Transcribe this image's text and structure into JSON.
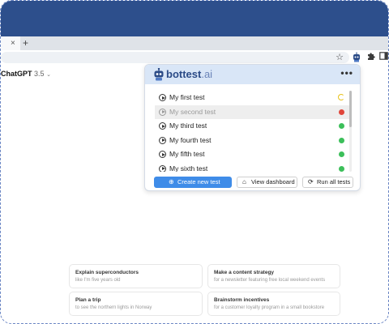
{
  "browser": {
    "tab_close": "×",
    "new_tab": "+",
    "toolbar_icons": {
      "star": "star-icon",
      "extension_avatar": "bottest-extension-icon",
      "extensions": "puzzle-icon",
      "sidepanel": "sidepanel-icon"
    }
  },
  "chatgpt": {
    "model_name": "ChatGPT",
    "model_version": "3.5",
    "model_chevron": "⌄",
    "suggestions": [
      {
        "title": "Explain superconductors",
        "subtitle": "like I'm five years old"
      },
      {
        "title": "Make a content strategy",
        "subtitle": "for a newsletter featuring free local weekend events"
      },
      {
        "title": "Plan a trip",
        "subtitle": "to see the northern lights in Norway"
      },
      {
        "title": "Brainstorm incentives",
        "subtitle": "for a customer loyalty program in a small bookstore"
      }
    ]
  },
  "bottest": {
    "brand": "bottest",
    "brand_suffix": ".ai",
    "more": "•••",
    "tests": [
      {
        "name": "My first test",
        "status": "running"
      },
      {
        "name": "My second test",
        "status": "failed"
      },
      {
        "name": "My third test",
        "status": "passed"
      },
      {
        "name": "My fourth test",
        "status": "passed"
      },
      {
        "name": "My fifth test",
        "status": "passed"
      },
      {
        "name": "My sixth test",
        "status": "passed"
      }
    ],
    "status_colors": {
      "running": "#e8c21a",
      "failed": "#e0463a",
      "passed": "#3cbf5a"
    },
    "buttons": {
      "create": "Create new test",
      "dashboard": "View dashboard",
      "run_all": "Run all tests"
    }
  }
}
